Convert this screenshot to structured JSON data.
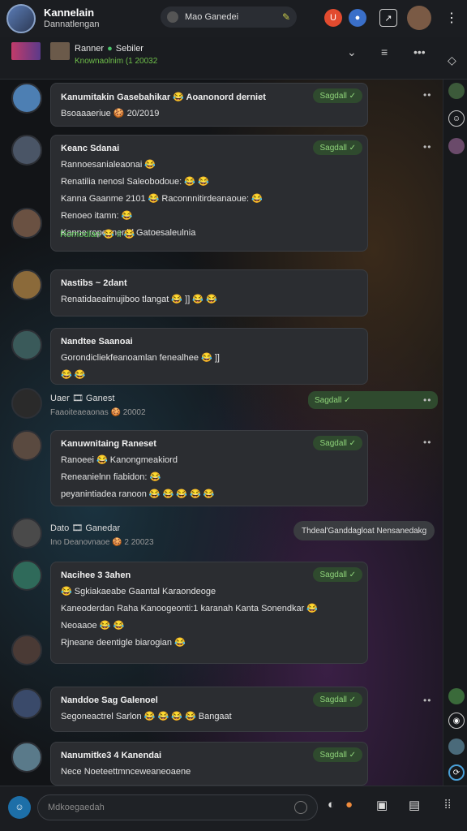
{
  "header": {
    "title": "Kannelain",
    "subtitle": "Dannatlengan",
    "search_text": "Mao Ganedei",
    "badge_orange": "U",
    "badge_blue": "●"
  },
  "channel": {
    "name": "Ranner",
    "status": "Sebiler",
    "sub": "Knownaolnim (1 20032"
  },
  "tag": "Sagdall ✓",
  "messages": [
    {
      "name": "Kanumitakin Gasebahikar 😂 Aoanonord derniet",
      "sub": "Bsoaaaeriue 🍪 20/2019",
      "lines": []
    },
    {
      "name": "Keanc Sdanai",
      "lines": [
        "Rannoesanialeaonai 😂",
        "Renatilia nenosl Saleobodoue: 😂 😂",
        "Kanna Gaanme 2101 😂 Raconnnitirdeanaoue: 😂",
        "Renoeo itamn: 😂",
        "Kanne ropeanenbl Gatoesaleulnia",
        "Romodian 😂 Il 😂"
      ]
    },
    {
      "name": "Nastibs ~ 2dant",
      "lines": [
        "Renatidaeaitnujiboo tlangat 😂 ]] 😂 😂"
      ]
    },
    {
      "name": "Nandtee Saanoai",
      "lines": [
        "Gorondicliekfeanoamlan fenealhee 😂 ]]",
        "😂 😂"
      ]
    },
    {
      "name": "Uaer 🎞 Ganest",
      "sub": "Faaoiteaeaonas 🍪 20002",
      "lines": []
    },
    {
      "name": "Kanuwnitaing Raneset",
      "lines": [
        "Ranoeei 😂 Kanongmeakiord",
        "Reneanielnn fiabidon: 😂",
        "peyanintiadea ranoon 😂 😂 😂 😂 😂"
      ]
    },
    {
      "name": "Dato 🎞 Ganedar",
      "sub": "Ino Deanovnaoe 🍪 2 20023",
      "lines": [],
      "pill": "Thdeal'Ganddagloat Nensanedakg"
    },
    {
      "name": "Nacihee 3 3ahen",
      "lines": [
        "😂 Sgkiakaeabe Gaantal Karaondeoge",
        "Kaneoderdan Raha Kanoogeonti:1 karanah Kanta Sonendkar 😂",
        "Neoaaoe 😂 😂",
        "Rjneane deentigle biarogian 😂"
      ]
    },
    {
      "name": "Nanddoe Sag Galenoel",
      "lines": [
        "Segoneactrel Sarlon 😂 😂 😂 😂 Bangaat"
      ]
    },
    {
      "name": "Nanumitke3 4 Kanendai",
      "lines": [
        "Nece Noeteettmnceweaneoaene"
      ]
    }
  ],
  "compose": {
    "placeholder": "Mdkoegaedah"
  },
  "colors": {
    "accent": "#5fc25a",
    "orange": "#f08b3c",
    "bg": "#121417",
    "card": "#2b2d31"
  }
}
